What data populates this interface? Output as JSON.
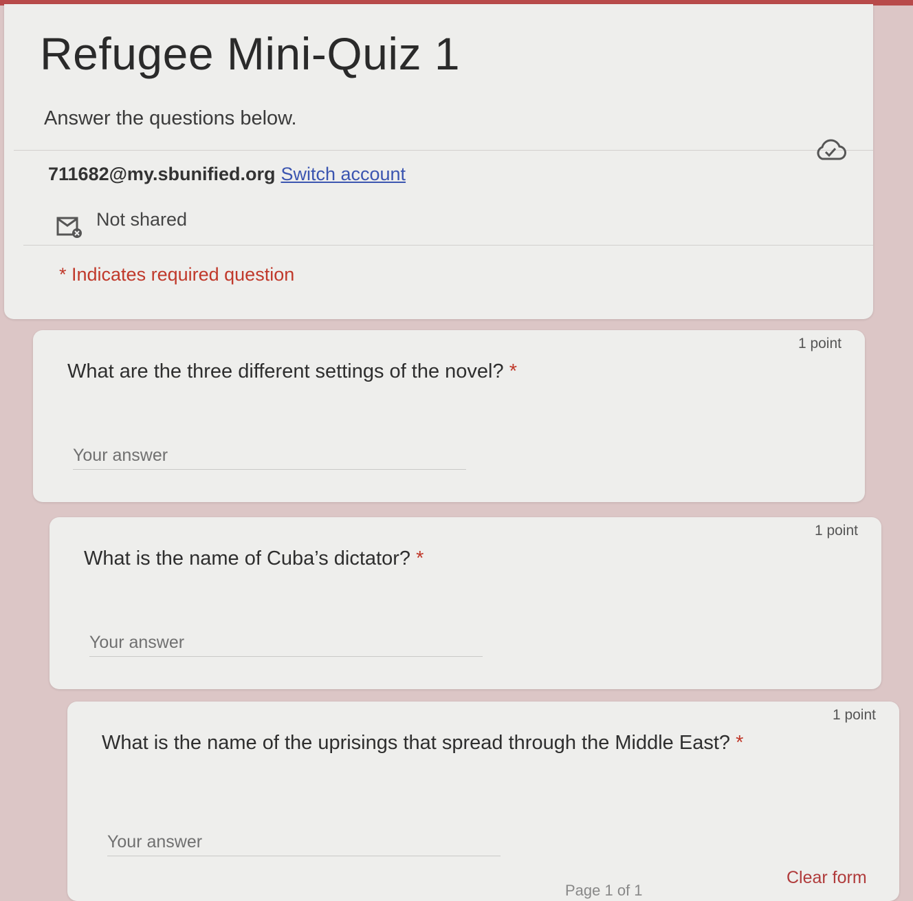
{
  "form": {
    "title": "Refugee Mini-Quiz 1",
    "description": "Answer the questions below."
  },
  "account": {
    "email": "711682@my.sbunified.org",
    "switch_label": "Switch account",
    "saved_icon": "cloud-check-icon",
    "sharing_icon": "email-crossed-icon",
    "sharing_status": "Not shared"
  },
  "required_note": "* Indicates required question",
  "questions": [
    {
      "text": "What are the three different settings of the novel?",
      "required_mark": "*",
      "points": "1 point",
      "placeholder": "Your answer"
    },
    {
      "text": "What is the name of Cuba’s dictator?",
      "required_mark": "*",
      "points": "1 point",
      "placeholder": "Your answer"
    },
    {
      "text": "What is the name of the uprisings that spread through the Middle East?",
      "required_mark": "*",
      "points": "1 point",
      "placeholder": "Your answer"
    }
  ],
  "footer": {
    "clear_label": "Clear form",
    "page_indicator": "Page 1 of 1"
  },
  "colors": {
    "accent": "#b84a4a",
    "required": "#c0392b",
    "link": "#3b55b0"
  }
}
